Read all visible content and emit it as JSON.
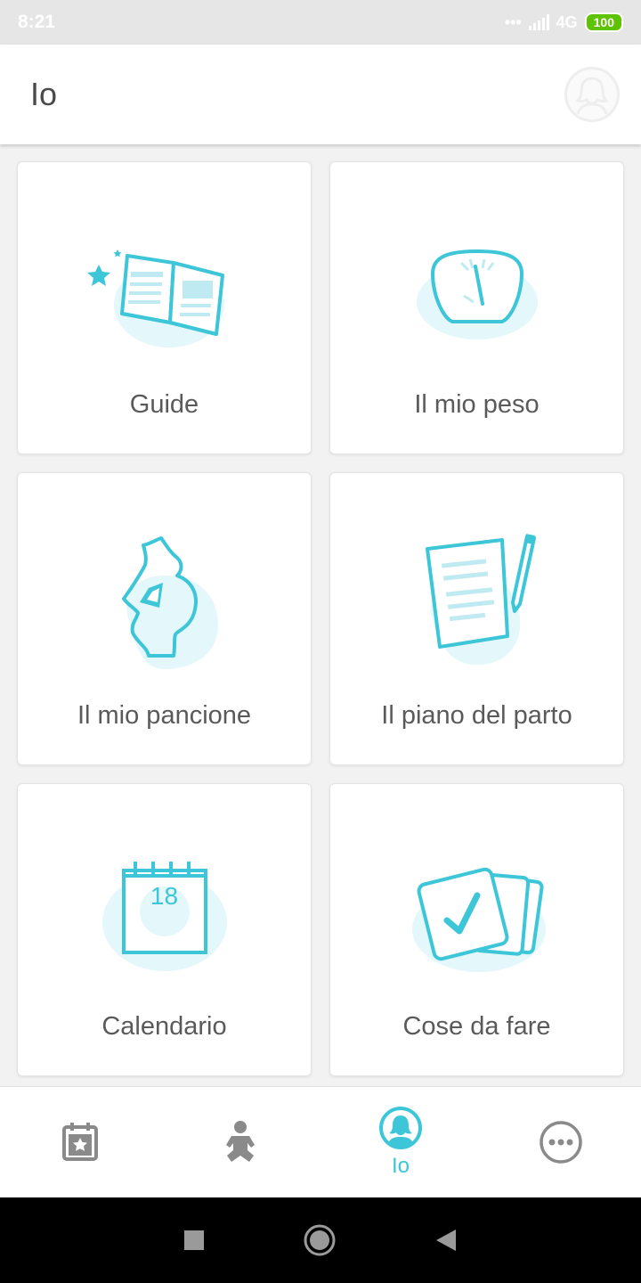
{
  "status_bar": {
    "time": "8:21",
    "network": "4G",
    "battery": "100"
  },
  "header": {
    "title": "Io"
  },
  "cards": [
    {
      "label": "Guide",
      "icon": "open-book-icon"
    },
    {
      "label": "Il mio peso",
      "icon": "scale-icon"
    },
    {
      "label": "Il mio pancione",
      "icon": "pregnant-belly-icon"
    },
    {
      "label": "Il piano del parto",
      "icon": "document-pen-icon"
    },
    {
      "label": "Calendario",
      "icon": "calendar-icon",
      "calendar_day": "18"
    },
    {
      "label": "Cose da fare",
      "icon": "checklist-cards-icon"
    }
  ],
  "bottom_nav": {
    "items": [
      {
        "icon": "calendar-star-icon",
        "label": ""
      },
      {
        "icon": "baby-icon",
        "label": ""
      },
      {
        "icon": "user-profile-icon",
        "label": "Io",
        "active": true
      },
      {
        "icon": "more-icon",
        "label": ""
      }
    ]
  },
  "colors": {
    "accent": "#3cc6d8",
    "accent_light": "#e4f7fa",
    "text": "#5a5a5a",
    "nav_inactive": "#8a8a8a"
  }
}
